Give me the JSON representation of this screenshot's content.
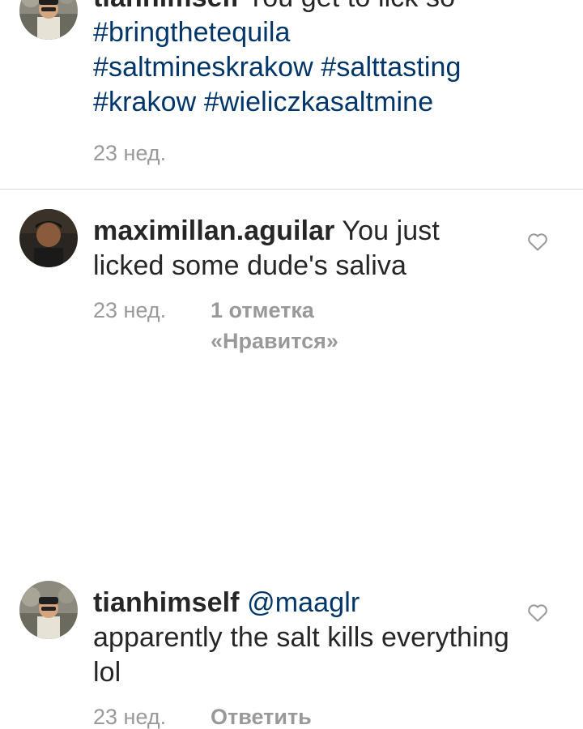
{
  "colors": {
    "text": "#262626",
    "hashtag": "#003569",
    "meta": "#999999",
    "divider": "#dbdbdb"
  },
  "comments": [
    {
      "username": "tianhimself",
      "text": "You get to lick so",
      "hashtags": [
        "#bringthetequila",
        "#saltmineskrakow",
        "#salttasting",
        "#krakow",
        "#wieliczkasaltmine"
      ],
      "time": "23 нед."
    },
    {
      "username": "maximillan.aguilar",
      "text": "You just licked some dude's saliva",
      "time": "23 нед.",
      "likes_line1": "1 отметка",
      "likes_line2": "«Нравится»",
      "like_icon": "heart-outline-icon"
    },
    {
      "username": "tianhimself",
      "mention": "@maaglr",
      "text": "apparently the salt kills everything lol",
      "time": "23 нед.",
      "reply_label": "Ответить",
      "like_icon": "heart-outline-icon"
    }
  ]
}
